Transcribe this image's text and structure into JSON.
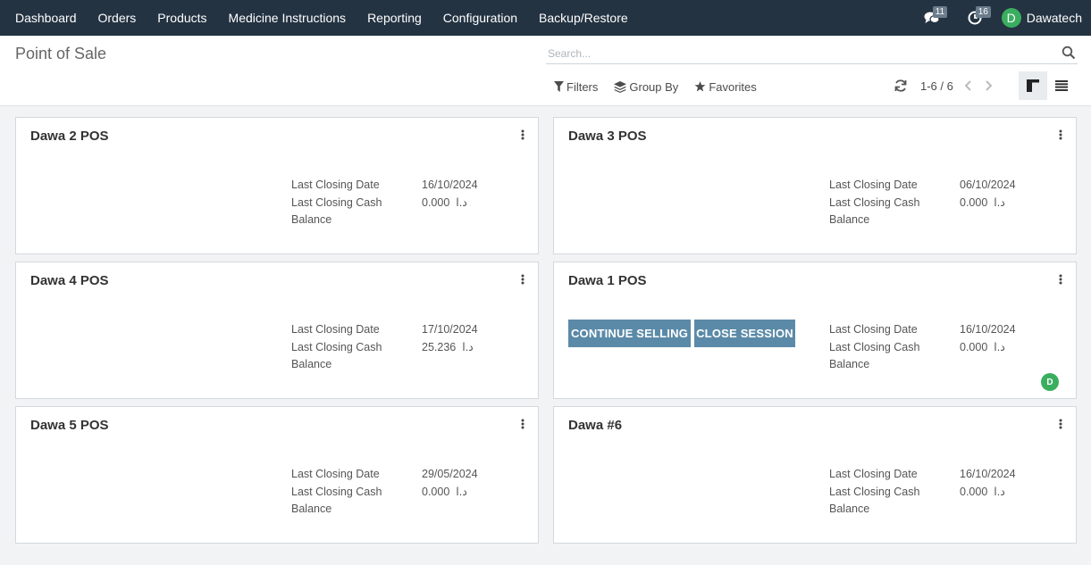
{
  "nav": {
    "items": [
      "Dashboard",
      "Orders",
      "Products",
      "Medicine Instructions",
      "Reporting",
      "Configuration",
      "Backup/Restore"
    ],
    "messages_count": "11",
    "activities_count": "16",
    "user_initial": "D",
    "user_name": "Dawatech"
  },
  "control": {
    "title": "Point of Sale",
    "search_placeholder": "Search...",
    "filters_label": "Filters",
    "groupby_label": "Group By",
    "favorites_label": "Favorites",
    "pager": "1-6 / 6"
  },
  "labels": {
    "last_closing_date": "Last Closing Date",
    "last_closing_cash": "Last Closing Cash",
    "balance": "Balance",
    "currency": "د.ا"
  },
  "cards": [
    {
      "name": "Dawa 2 POS",
      "date": "16/10/2024",
      "cash": "0.000"
    },
    {
      "name": "Dawa 3 POS",
      "date": "06/10/2024",
      "cash": "0.000"
    },
    {
      "name": "Dawa 4 POS",
      "date": "17/10/2024",
      "cash": "25.236"
    },
    {
      "name": "Dawa 1 POS",
      "date": "16/10/2024",
      "cash": "0.000",
      "continue_label": "CONTINUE SELLING",
      "close_label": "CLOSE SESSION",
      "user_initial": "D"
    },
    {
      "name": "Dawa 5 POS",
      "date": "29/05/2024",
      "cash": "0.000"
    },
    {
      "name": "Dawa #6",
      "date": "16/10/2024",
      "cash": "0.000"
    }
  ],
  "colors": {
    "navbar": "#243342",
    "primary_button": "#5b8aa8",
    "avatar": "#3aae5f"
  }
}
